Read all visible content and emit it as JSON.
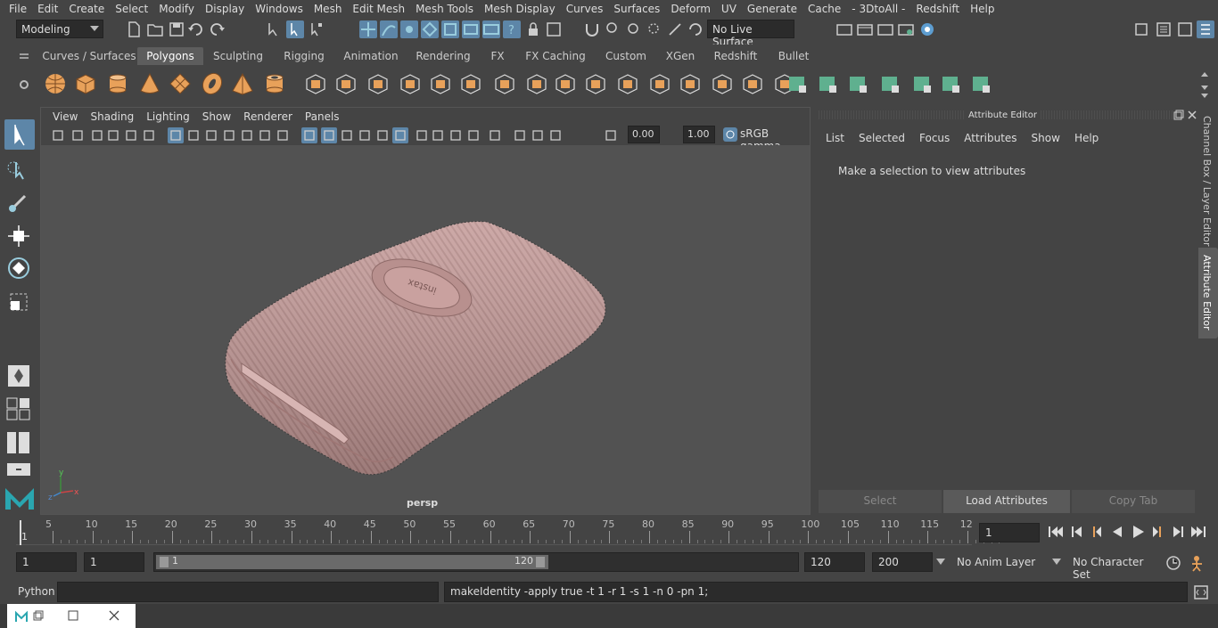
{
  "menubar": [
    "File",
    "Edit",
    "Create",
    "Select",
    "Modify",
    "Display",
    "Windows",
    "Mesh",
    "Edit Mesh",
    "Mesh Tools",
    "Mesh Display",
    "Curves",
    "Surfaces",
    "Deform",
    "UV",
    "Generate",
    "Cache",
    "- 3DtoAll -",
    "Redshift",
    "Help"
  ],
  "status": {
    "mode": "Modeling",
    "live_surface": "No Live Surface"
  },
  "shelf_tabs": [
    "Curves / Surfaces",
    "Polygons",
    "Sculpting",
    "Rigging",
    "Animation",
    "Rendering",
    "FX",
    "FX Caching",
    "Custom",
    "XGen",
    "Redshift",
    "Bullet"
  ],
  "shelf_active": "Polygons",
  "viewport": {
    "menu": [
      "View",
      "Shading",
      "Lighting",
      "Show",
      "Renderer",
      "Panels"
    ],
    "exposure": "0.00",
    "gamma": "1.00",
    "colorspace": "sRGB gamma",
    "camera": "persp",
    "product_text": "instax"
  },
  "attr": {
    "title": "Attribute Editor",
    "menu": [
      "List",
      "Selected",
      "Focus",
      "Attributes",
      "Show",
      "Help"
    ],
    "message": "Make a selection to view attributes",
    "buttons": {
      "select": "Select",
      "load": "Load Attributes",
      "copy": "Copy Tab"
    }
  },
  "sidebar": {
    "channel_box": "Channel Box / Layer Editor",
    "attr_editor": "Attribute Editor"
  },
  "timeline": {
    "ticks": [
      "5",
      "10",
      "15",
      "20",
      "25",
      "30",
      "35",
      "40",
      "45",
      "50",
      "55",
      "60",
      "65",
      "70",
      "75",
      "80",
      "85",
      "90",
      "95",
      "100",
      "105",
      "110",
      "115",
      "12"
    ],
    "start_label": "1",
    "current_frame": "1"
  },
  "range": {
    "start": "1",
    "anim_start": "1",
    "slider_start": "1",
    "slider_end": "120",
    "anim_end": "120",
    "end": "200",
    "anim_layer": "No Anim Layer",
    "char_set": "No Character Set"
  },
  "cmd": {
    "lang": "Python",
    "result": "makeIdentity -apply true -t 1 -r 1 -s 1 -n 0 -pn 1;"
  },
  "colors": {
    "shelf_orange": "#e8a15a",
    "shelf_teal": "#5fb08f",
    "select_blue": "#5d86a8",
    "model_pink": "#c49a98"
  }
}
